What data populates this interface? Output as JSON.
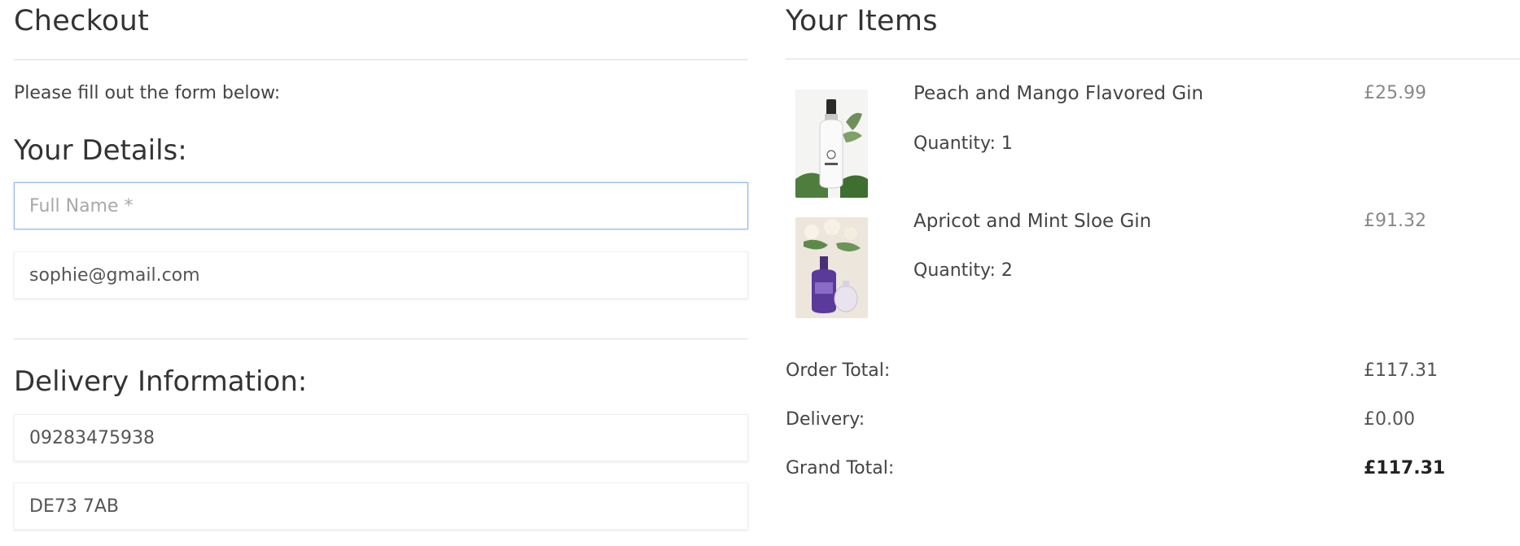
{
  "checkout": {
    "title": "Checkout",
    "intro": "Please fill out the form below:",
    "details_heading": "Your Details:",
    "full_name_placeholder": "Full Name *",
    "email_value": "sophie@gmail.com",
    "delivery_heading": "Delivery Information:",
    "phone_value": "09283475938",
    "postcode_value": "DE73 7AB"
  },
  "cart": {
    "title": "Your Items",
    "items": [
      {
        "name": "Peach and Mango Flavored Gin",
        "quantity": "Quantity: 1",
        "price": "£25.99",
        "image": "gin-bottle-clear"
      },
      {
        "name": "Apricot and Mint Sloe Gin",
        "quantity": "Quantity: 2",
        "price": "£91.32",
        "image": "gin-bottle-purple"
      }
    ],
    "summary": {
      "order_total_label": "Order Total:",
      "order_total": "£117.31",
      "delivery_label": "Delivery:",
      "delivery": "£0.00",
      "grand_total_label": "Grand Total:",
      "grand_total": "£117.31"
    }
  },
  "colors": {
    "focus_border": "#8fb4f0",
    "divider": "#dcdcdc",
    "price_text": "#888888"
  }
}
